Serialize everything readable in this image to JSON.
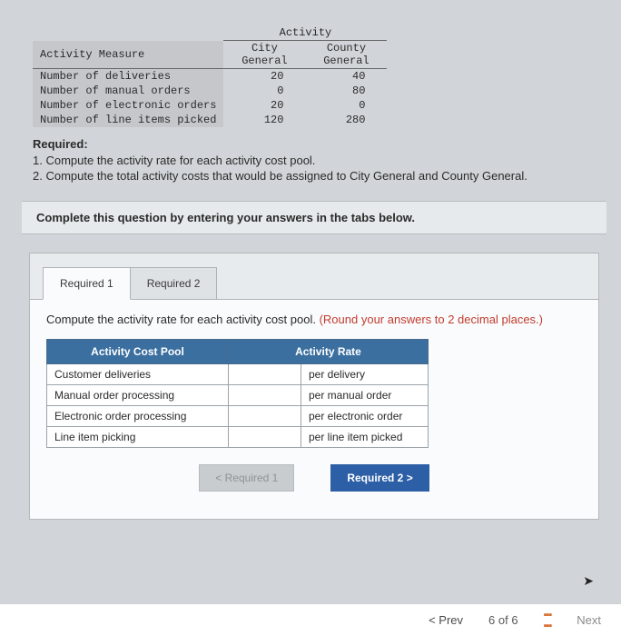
{
  "dataTable": {
    "activityHeader": "Activity",
    "measureHeader": "Activity Measure",
    "columns": [
      "City General",
      "County General"
    ],
    "rows": [
      {
        "label": "Number of deliveries",
        "vals": [
          "20",
          "40"
        ]
      },
      {
        "label": "Number of manual orders",
        "vals": [
          "0",
          "80"
        ]
      },
      {
        "label": "Number of electronic orders",
        "vals": [
          "20",
          "0"
        ]
      },
      {
        "label": "Number of line items picked",
        "vals": [
          "120",
          "280"
        ]
      }
    ]
  },
  "required": {
    "heading": "Required:",
    "items": [
      "1. Compute the activity rate for each activity cost pool.",
      "2. Compute the total activity costs that would be assigned to City General and County General."
    ]
  },
  "instructionBar": "Complete this question by entering your answers in the tabs below.",
  "tabs": {
    "t1": "Required 1",
    "t2": "Required 2"
  },
  "panel": {
    "text": "Compute the activity rate for each activity cost pool. ",
    "hint": "(Round your answers to 2 decimal places.)",
    "headers": {
      "pool": "Activity Cost Pool",
      "rate": "Activity Rate"
    },
    "rows": [
      {
        "pool": "Customer deliveries",
        "unit": "per delivery"
      },
      {
        "pool": "Manual order processing",
        "unit": "per manual order"
      },
      {
        "pool": "Electronic order processing",
        "unit": "per electronic order"
      },
      {
        "pool": "Line item picking",
        "unit": "per line item picked"
      }
    ]
  },
  "nav": {
    "prevBtn": "<  Required 1",
    "nextBtn": "Required 2  >"
  },
  "bottom": {
    "prev": "< Prev",
    "pager": "6 of 6",
    "next": "Next"
  }
}
